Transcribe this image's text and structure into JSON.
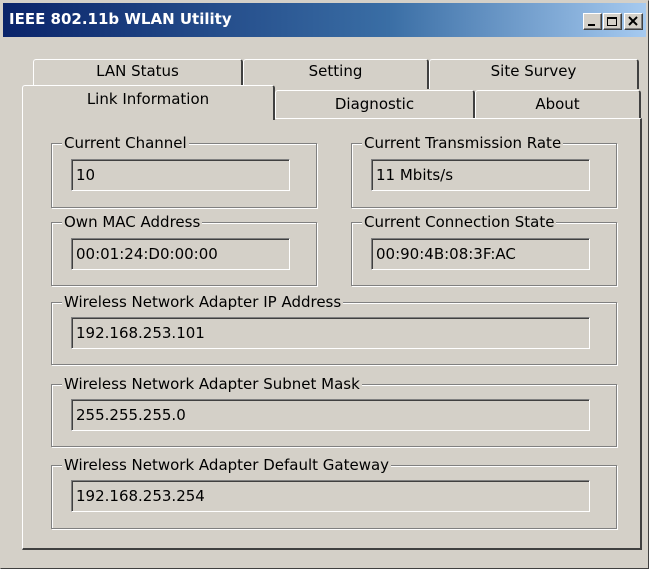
{
  "window": {
    "title": "IEEE 802.11b WLAN Utility",
    "controls": {
      "minimize": "minimize-icon",
      "restore": "restore-icon",
      "close": "close-icon"
    }
  },
  "tabs": {
    "row_back": [
      {
        "label": "LAN Status"
      },
      {
        "label": "Setting"
      },
      {
        "label": "Site Survey"
      }
    ],
    "row_front": [
      {
        "label": "Link Information",
        "selected": true
      },
      {
        "label": "Diagnostic"
      },
      {
        "label": "About"
      }
    ]
  },
  "link_info": {
    "current_channel": {
      "label": "Current Channel",
      "value": "10"
    },
    "transmission_rate": {
      "label": "Current Transmission Rate",
      "value": "11 Mbits/s"
    },
    "own_mac": {
      "label": "Own MAC Address",
      "value": "00:01:24:D0:00:00"
    },
    "connection_state": {
      "label": "Current Connection State",
      "value": "00:90:4B:08:3F:AC"
    },
    "ip_address": {
      "label": "Wireless Network Adapter IP Address",
      "value": "192.168.253.101"
    },
    "subnet_mask": {
      "label": "Wireless Network Adapter Subnet Mask",
      "value": "255.255.255.0"
    },
    "default_gateway": {
      "label": "Wireless Network Adapter Default Gateway",
      "value": "192.168.253.254"
    }
  },
  "colors": {
    "titlebar_start": "#0a246a",
    "titlebar_end": "#a6caf0",
    "face": "#d4d0c8"
  }
}
